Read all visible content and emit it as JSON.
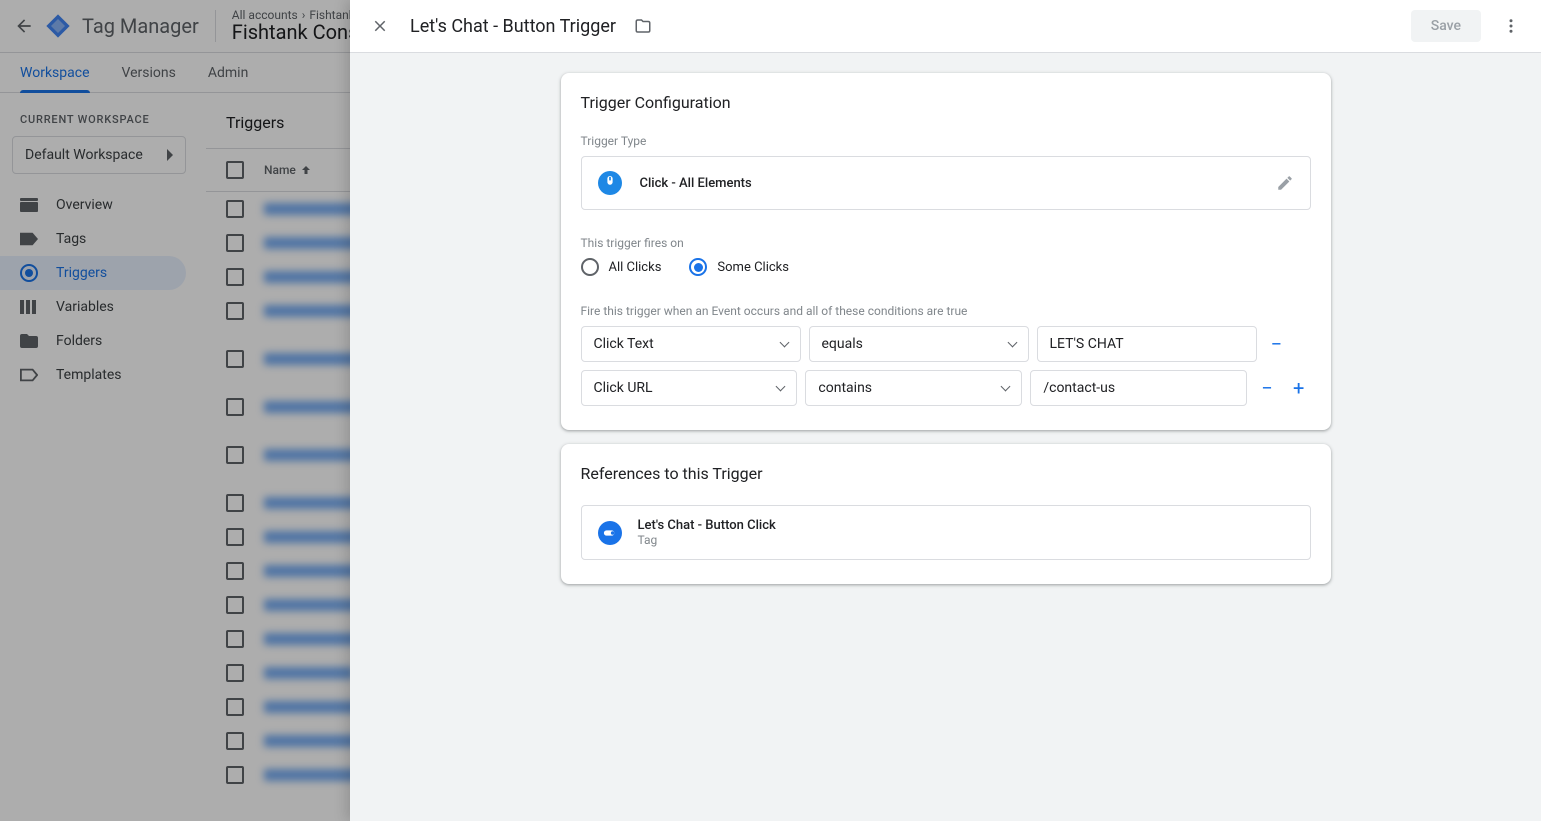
{
  "header": {
    "brand": "Tag Manager",
    "breadcrumb": [
      "All accounts",
      "Fishtank Tag M"
    ],
    "account": "Fishtank Consult"
  },
  "tabs": [
    "Workspace",
    "Versions",
    "Admin"
  ],
  "sidebar": {
    "label": "CURRENT WORKSPACE",
    "selector": "Default Workspace",
    "items": [
      {
        "label": "Overview"
      },
      {
        "label": "Tags"
      },
      {
        "label": "Triggers"
      },
      {
        "label": "Variables"
      },
      {
        "label": "Folders"
      },
      {
        "label": "Templates"
      }
    ]
  },
  "content": {
    "title": "Triggers",
    "col_name": "Name"
  },
  "panel": {
    "title": "Let's Chat - Button Trigger",
    "save": "Save",
    "config_heading": "Trigger Configuration",
    "trigger_type_label": "Trigger Type",
    "trigger_type": "Click - All Elements",
    "fires_on_label": "This trigger fires on",
    "radio_all": "All Clicks",
    "radio_some": "Some Clicks",
    "condition_label": "Fire this trigger when an Event occurs and all of these conditions are true",
    "conditions": [
      {
        "var": "Click Text",
        "op": "equals",
        "val": "LET'S CHAT"
      },
      {
        "var": "Click URL",
        "op": "contains",
        "val": "/contact-us"
      }
    ],
    "refs_heading": "References to this Trigger",
    "ref_name": "Let's Chat - Button Click",
    "ref_type": "Tag"
  }
}
